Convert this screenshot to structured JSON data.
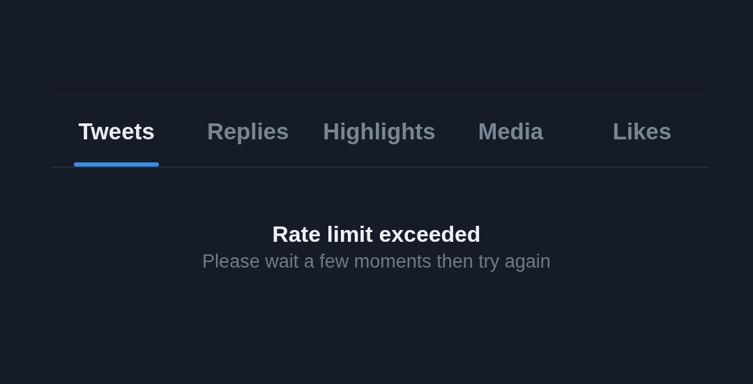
{
  "tabs": [
    {
      "label": "Tweets",
      "selected": true
    },
    {
      "label": "Replies",
      "selected": false
    },
    {
      "label": "Highlights",
      "selected": false
    },
    {
      "label": "Media",
      "selected": false
    },
    {
      "label": "Likes",
      "selected": false
    }
  ],
  "message": {
    "title": "Rate limit exceeded",
    "subtitle": "Please wait a few moments then try again"
  }
}
